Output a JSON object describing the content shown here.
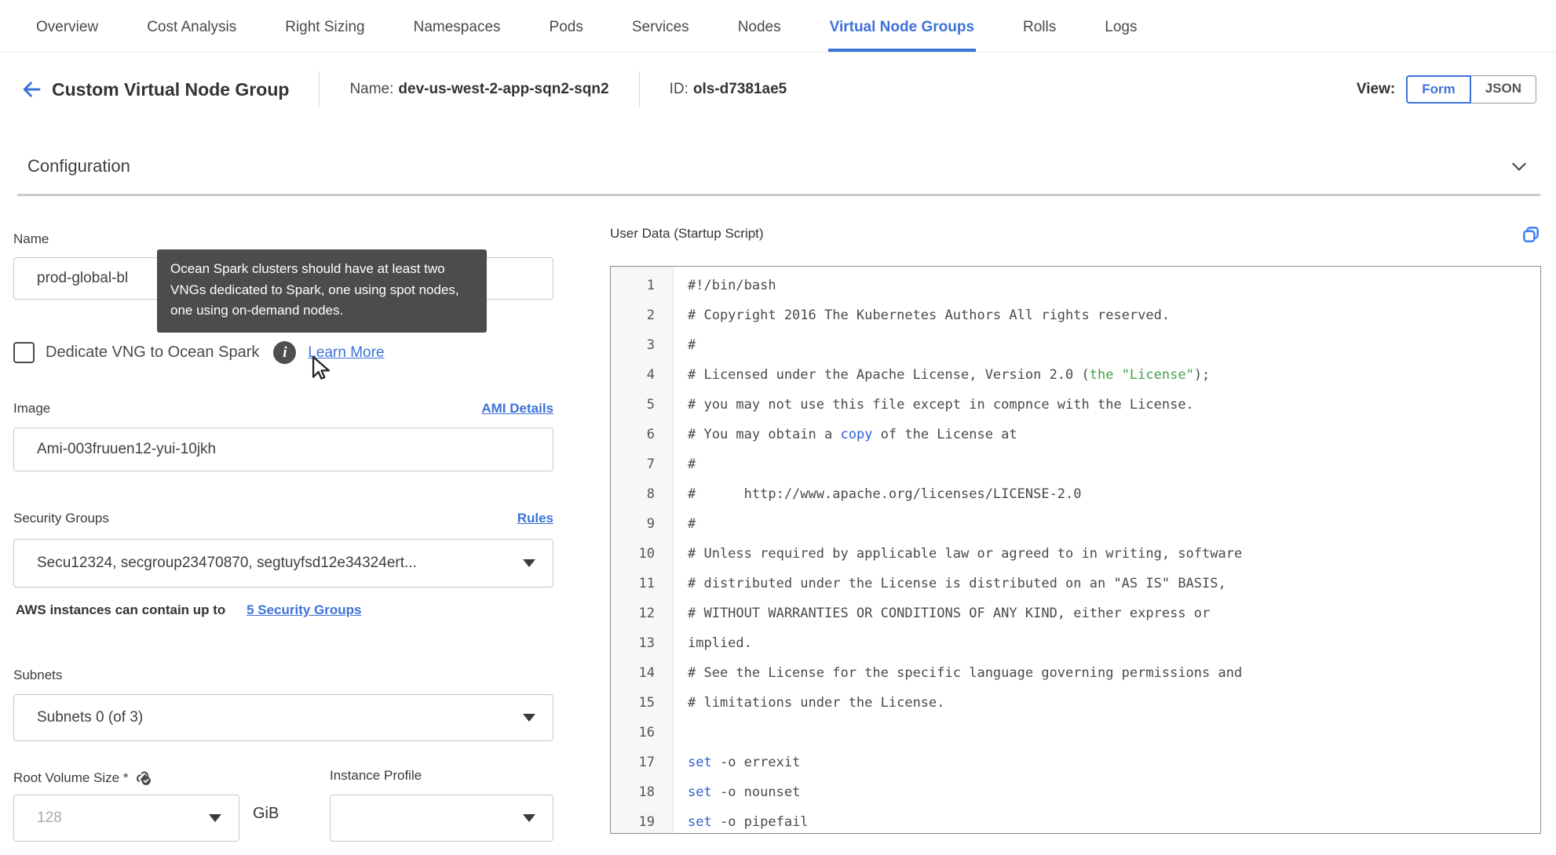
{
  "tabs": {
    "items": [
      {
        "label": "Overview",
        "active": false
      },
      {
        "label": "Cost Analysis",
        "active": false
      },
      {
        "label": "Right Sizing",
        "active": false
      },
      {
        "label": "Namespaces",
        "active": false
      },
      {
        "label": "Pods",
        "active": false
      },
      {
        "label": "Services",
        "active": false
      },
      {
        "label": "Nodes",
        "active": false
      },
      {
        "label": "Virtual Node Groups",
        "active": true
      },
      {
        "label": "Rolls",
        "active": false
      },
      {
        "label": "Logs",
        "active": false
      }
    ]
  },
  "header": {
    "title": "Custom Virtual Node Group",
    "name_prefix": "Name:",
    "name_value": "dev-us-west-2-app-sqn2-sqn2",
    "id_prefix": "ID:",
    "id_value": "ols-d7381ae5",
    "view_label": "View:",
    "view_form": "Form",
    "view_json": "JSON",
    "active_view": "Form"
  },
  "section": {
    "title": "Configuration"
  },
  "form": {
    "name": {
      "label": "Name",
      "value": "prod-global-bl"
    },
    "tooltip": {
      "text": "Ocean Spark clusters should have at least two VNGs dedicated to Spark, one using spot nodes, one using on-demand nodes."
    },
    "dedicate": {
      "label": "Dedicate VNG to Ocean Spark",
      "checked": false,
      "learn_more": "Learn More"
    },
    "image": {
      "label": "Image",
      "link": "AMI Details",
      "value": "Ami-003fruuen12-yui-10jkh"
    },
    "security_groups": {
      "label": "Security Groups",
      "link": "Rules",
      "value": "Secu12324, secgroup23470870, segtuyfsd12e34324ert...",
      "helper_text": "AWS instances can contain up to",
      "helper_link": "5 Security Groups"
    },
    "subnets": {
      "label": "Subnets",
      "value": "Subnets 0 (of 3)"
    },
    "root_volume": {
      "label": "Root Volume Size *",
      "placeholder": "128",
      "unit": "GiB"
    },
    "instance_profile": {
      "label": "Instance Profile",
      "value": ""
    }
  },
  "editor": {
    "title": "User Data (Startup Script)",
    "lines": [
      [
        {
          "t": "#!/bin/bash",
          "c": "d"
        }
      ],
      [
        {
          "t": "# Copyright 2016 The Kubernetes Authors All rights reserved.",
          "c": "d"
        }
      ],
      [
        {
          "t": "#",
          "c": "d"
        }
      ],
      [
        {
          "t": "# Licensed under the Apache License, Version 2.0 (",
          "c": "d"
        },
        {
          "t": "the \"License\"",
          "c": "g"
        },
        {
          "t": ");",
          "c": "d"
        }
      ],
      [
        {
          "t": "# you may not use this file except in compnce with the License.",
          "c": "d"
        }
      ],
      [
        {
          "t": "# You may obtain a ",
          "c": "d"
        },
        {
          "t": "copy",
          "c": "b"
        },
        {
          "t": " of the License at",
          "c": "d"
        }
      ],
      [
        {
          "t": "#",
          "c": "d"
        }
      ],
      [
        {
          "t": "#      http://www.apache.org/licenses/LICENSE-2.0",
          "c": "d"
        }
      ],
      [
        {
          "t": "#",
          "c": "d"
        }
      ],
      [
        {
          "t": "# Unless required by applicable law or agreed to in writing, software",
          "c": "d"
        }
      ],
      [
        {
          "t": "# distributed under the License is distributed on an \"AS IS\" BASIS,",
          "c": "d"
        }
      ],
      [
        {
          "t": "# WITHOUT WARRANTIES OR CONDITIONS OF ANY KIND, either express or",
          "c": "d"
        }
      ],
      [
        {
          "t": "implied.",
          "c": "d"
        }
      ],
      [
        {
          "t": "# See the License for the specific language governing permissions and",
          "c": "d"
        }
      ],
      [
        {
          "t": "# limitations under the License.",
          "c": "d"
        }
      ],
      [],
      [
        {
          "t": "set",
          "c": "b"
        },
        {
          "t": " -o errexit",
          "c": "d"
        }
      ],
      [
        {
          "t": "set",
          "c": "b"
        },
        {
          "t": " -o nounset",
          "c": "d"
        }
      ],
      [
        {
          "t": "set",
          "c": "b"
        },
        {
          "t": " -o pipefail",
          "c": "d"
        }
      ]
    ]
  },
  "colors": {
    "accent_blue": "#3d72d9",
    "copy_icon_blue": "#4285f4",
    "tooltip_bg": "#4c4c4c",
    "code_green": "#3fa447",
    "code_blue": "#2d5fd3",
    "code_default": "#4a4a4a"
  }
}
